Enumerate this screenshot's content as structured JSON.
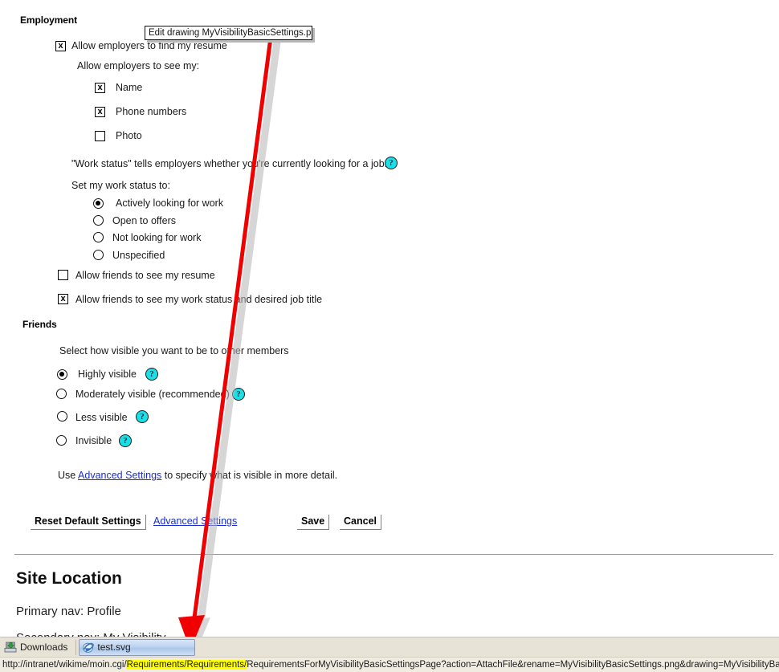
{
  "tooltip": {
    "text": "Edit drawing MyVisibilityBasicSettings.png"
  },
  "employment": {
    "title": "Employment",
    "allow_employers_find_resume": "Allow employers to find my resume",
    "allow_employers_see_my": "Allow employers to see my:",
    "see_options": [
      {
        "label": "Name",
        "checked": "x"
      },
      {
        "label": "Phone numbers",
        "checked": "x"
      },
      {
        "label": "Photo",
        "checked": ""
      }
    ],
    "work_status_note": "\"Work status\" tells employers whether you're currently looking for a job.",
    "set_work_status_label": "Set my work status to:",
    "work_status_options": [
      "Actively looking for work",
      "Open to offers",
      "Not looking for work",
      "Unspecified"
    ],
    "allow_friends_resume": "Allow friends to see my resume",
    "allow_friends_status": "Allow friends to see my work status and desired job title"
  },
  "friends": {
    "title": "Friends",
    "prompt": "Select how visible you want to be to other members",
    "options": [
      "Highly visible",
      "Moderately visible (recommended)",
      "Less visible",
      "Invisible"
    ],
    "advanced_prefix": "Use",
    "advanced_link": "Advanced Settings",
    "advanced_suffix": "to specify what is visible in more detail."
  },
  "buttons": {
    "reset": "Reset Default Settings",
    "advanced": "Advanced Settings",
    "save": "Save",
    "cancel": "Cancel"
  },
  "site_location": {
    "title": "Site Location",
    "primary_nav": "Primary nav: Profile",
    "secondary_nav": "Secondary nav: My Visibility"
  },
  "taskbar": {
    "downloads": "Downloads",
    "window": "test.svg"
  },
  "statusbar": {
    "url_prefix": "http://intranet/wikime/moin.cgi/",
    "url_highlight": "Requirements/Requirements/",
    "url_suffix": "RequirementsForMyVisibilityBasicSettingsPage?action=AttachFile&rename=MyVisibilityBasicSettings.png&drawing=MyVisibilityBasicSettings"
  },
  "icons": {
    "help": "?",
    "checkbox_mark": "x"
  },
  "colors": {
    "help_bubble": "#19e0e8",
    "arrow": "#f00000",
    "arrow_shadow": "#bfbfbf",
    "link": "#1b2ed0",
    "highlight": "#ffff00",
    "taskbar": "#e8e3d7"
  }
}
